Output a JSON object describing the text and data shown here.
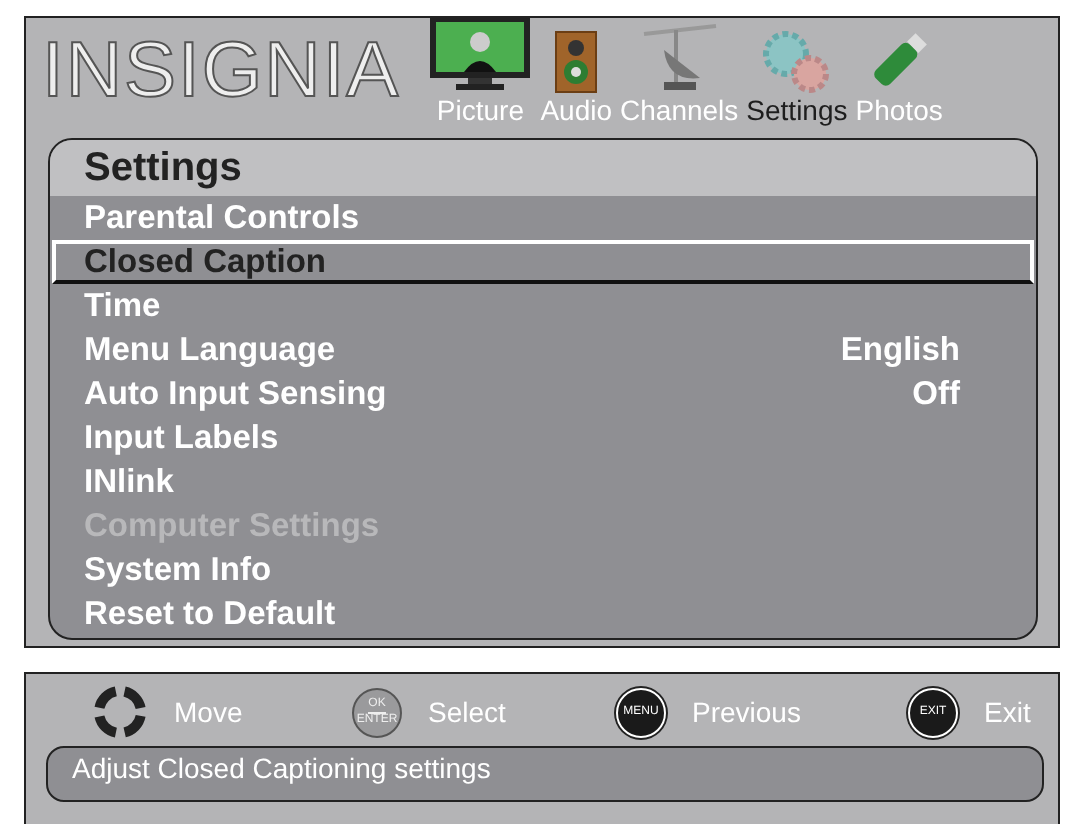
{
  "brand": "INSIGNIA",
  "tabs": [
    {
      "label": "Picture",
      "kind": "tv",
      "selected": false
    },
    {
      "label": "Audio",
      "kind": "speaker",
      "selected": false
    },
    {
      "label": "Channels",
      "kind": "antenna",
      "selected": false
    },
    {
      "label": "Settings",
      "kind": "gears",
      "selected": true
    },
    {
      "label": "Photos",
      "kind": "usb",
      "selected": false
    }
  ],
  "panel": {
    "title": "Settings",
    "items": [
      {
        "label": "Parental Controls",
        "selected": false,
        "disabled": false
      },
      {
        "label": "Closed Caption",
        "selected": true,
        "disabled": false
      },
      {
        "label": "Time",
        "selected": false,
        "disabled": false
      },
      {
        "label": "Menu Language",
        "value": "English",
        "selected": false,
        "disabled": false
      },
      {
        "label": "Auto Input Sensing",
        "value": "Off",
        "selected": false,
        "disabled": false
      },
      {
        "label": "Input Labels",
        "selected": false,
        "disabled": false
      },
      {
        "label": "INlink",
        "selected": false,
        "disabled": false
      },
      {
        "label": "Computer Settings",
        "selected": false,
        "disabled": true
      },
      {
        "label": "System Info",
        "selected": false,
        "disabled": false
      },
      {
        "label": "Reset to Default",
        "selected": false,
        "disabled": false
      }
    ]
  },
  "hints": [
    {
      "kind": "dpad",
      "label": "Move"
    },
    {
      "kind": "ok",
      "key_labels": [
        "OK",
        "ENTER"
      ],
      "label": "Select"
    },
    {
      "kind": "round",
      "key_labels": [
        "MENU"
      ],
      "label": "Previous"
    },
    {
      "kind": "round",
      "key_labels": [
        "EXIT"
      ],
      "label": "Exit"
    }
  ],
  "status": "Adjust Closed Captioning settings"
}
